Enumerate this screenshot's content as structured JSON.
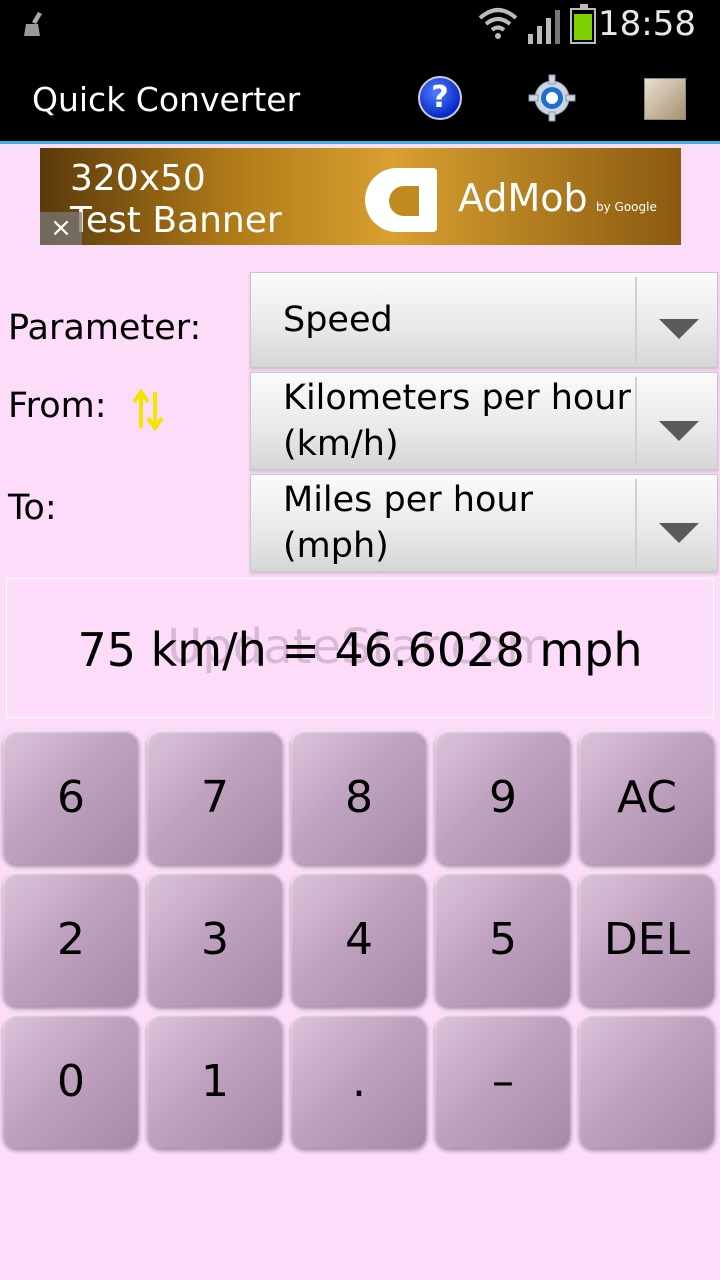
{
  "status_bar": {
    "time": "18:58"
  },
  "app_bar": {
    "title": "Quick Converter"
  },
  "ad": {
    "line1": "320x50",
    "line2": "Test Banner",
    "brand": "AdMob",
    "by": "by Google",
    "close": "×"
  },
  "form": {
    "parameter_label": "Parameter:",
    "from_label": "From:",
    "to_label": "To:",
    "parameter_value": "Speed",
    "from_value": "Kilometers per hour (km/h)",
    "to_value": "Miles per hour (mph)"
  },
  "result": {
    "text": "75 km/h = 46.6028 mph",
    "watermark": "UpdateStar.com"
  },
  "keypad": {
    "row1": [
      "6",
      "7",
      "8",
      "9",
      "AC"
    ],
    "row2": [
      "2",
      "3",
      "4",
      "5",
      "DEL"
    ],
    "row3": [
      "0",
      "1",
      ".",
      "–",
      ""
    ]
  },
  "colors": {
    "background": "#fcdcf8",
    "accent": "#33b5e5",
    "key": "#bfa2bf"
  }
}
